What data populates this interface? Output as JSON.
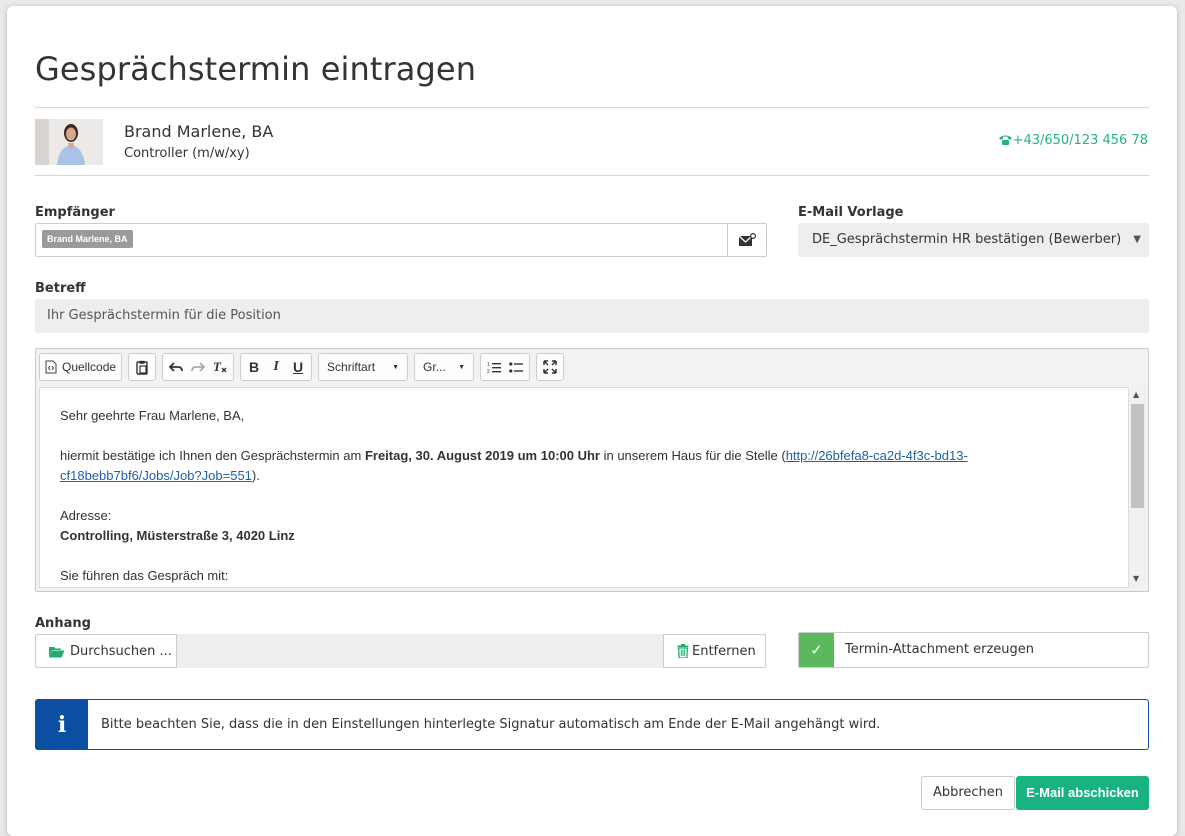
{
  "dialog": {
    "title": "Gesprächstermin eintragen"
  },
  "candidate": {
    "name": "Brand Marlene, BA",
    "position": "Controller (m/w/xy)",
    "phone": "+43/650/123 456 78"
  },
  "form": {
    "recipient_label": "Empfänger",
    "recipient_tag": "Brand Marlene, BA",
    "template_label": "E-Mail Vorlage",
    "template_value": "DE_Gesprächstermin HR bestätigen (Bewerber)",
    "subject_label": "Betreff",
    "subject_value": "Ihr Gesprächstermin für die Position"
  },
  "toolbar": {
    "source_label": "Quellcode",
    "font_label": "Schriftart",
    "size_label": "Gr..."
  },
  "body": {
    "greeting": "Sehr geehrte Frau Marlene, BA,",
    "line1_pre": "hiermit bestätige ich Ihnen den Gesprächstermin am ",
    "line1_bold": "Freitag, 30. August 2019 um 10:00 Uhr",
    "line1_post": " in unserem Haus für die Stelle (",
    "link_part1": "http://26bfefa8-ca2d-4f3c-bd13-",
    "link_part2": "cf18bebb7bf6/Jobs/Job?Job=551",
    "line1_end": ").",
    "address_label": "Adresse:",
    "address_value": "Controlling, Müsterstraße 3, 4020 Linz",
    "interview_line": "Sie führen das Gespräch mit:"
  },
  "attachment": {
    "label": "Anhang",
    "browse_label": "Durchsuchen ...",
    "remove_label": "Entfernen",
    "checkbox_label": "Termin-Attachment erzeugen",
    "checkbox_checked": true
  },
  "info": {
    "text": "Bitte beachten Sie, dass die in den Einstellungen hinterlegte Signatur automatisch am Ende der E-Mail angehängt wird."
  },
  "actions": {
    "cancel_label": "Abbrechen",
    "send_label": "E-Mail abschicken"
  },
  "colors": {
    "accent_green": "#19b383",
    "info_blue": "#0b4ea2",
    "check_green": "#5cb85c"
  }
}
